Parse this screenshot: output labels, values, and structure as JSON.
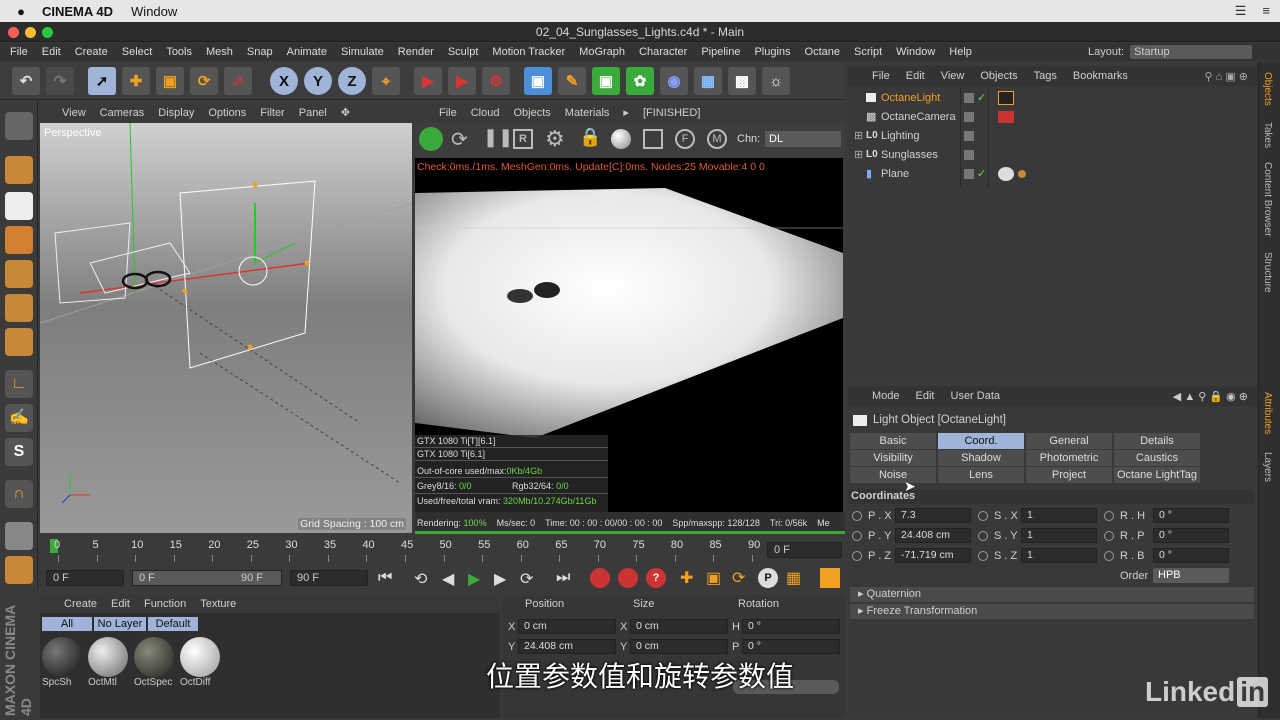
{
  "mac_menu": {
    "app": "CINEMA 4D",
    "window": "Window"
  },
  "window_title": "02_04_Sunglasses_Lights.c4d * - Main",
  "main_menu": [
    "File",
    "Edit",
    "Create",
    "Select",
    "Tools",
    "Mesh",
    "Snap",
    "Animate",
    "Simulate",
    "Render",
    "Sculpt",
    "Motion Tracker",
    "MoGraph",
    "Character",
    "Pipeline",
    "Plugins",
    "Octane",
    "Script",
    "Window",
    "Help"
  ],
  "layout": {
    "label": "Layout:",
    "value": "Startup"
  },
  "toolbar": {
    "x": "X",
    "y": "Y",
    "z": "Z"
  },
  "viewport": {
    "menu": [
      "View",
      "Cameras",
      "Display",
      "Options",
      "Filter",
      "Panel"
    ],
    "label": "Perspective",
    "grid_spacing": "Grid Spacing : 100 cm"
  },
  "render_view": {
    "menu": [
      "File",
      "Cloud",
      "Objects",
      "Materials"
    ],
    "status": "[FINISHED]",
    "channel_label": "Chn:",
    "channel_value": "DL",
    "info": "Check:0ms./1ms. MeshGen:0ms. Update[C]:0ms. Nodes:25 Movable:4  0 0",
    "gpu1": "GTX 1080 Ti[T][6.1]",
    "gpu2": "GTX 1080 Ti[6.1]",
    "out_of_core_label": "Out-of-core used/max:",
    "out_of_core_value": "0Kb/4Gb",
    "grey_label": "Grey8/16:",
    "grey_value": "0/0",
    "rgb_label": "Rgb32/64:",
    "rgb_value": "0/0",
    "vram_label": "Used/free/total vram:",
    "vram_value": "320Mb/10.274Gb/11Gb",
    "rendering_label": "Rendering:",
    "rendering_value": "100%",
    "ms_sec": "Ms/sec: 0",
    "time": "Time: 00 : 00 : 00/00 : 00 : 00",
    "spp": "Spp/maxspp: 128/128",
    "tri": "Tri: 0/56k",
    "me": "Me"
  },
  "timeline": {
    "ticks": [
      "0",
      "5",
      "10",
      "15",
      "20",
      "25",
      "30",
      "35",
      "40",
      "45",
      "50",
      "55",
      "60",
      "65",
      "70",
      "75",
      "80",
      "85",
      "90"
    ],
    "current_frame": "0 F",
    "start": "0 F",
    "min": "0 F",
    "max_inner": "90 F",
    "end": "90 F"
  },
  "material_manager": {
    "menu": [
      "Create",
      "Edit",
      "Function",
      "Texture"
    ],
    "filters": [
      "All",
      "No Layer",
      "Default"
    ],
    "materials": [
      "SpcSh",
      "OctMtl",
      "OctSpec",
      "OctDiff"
    ]
  },
  "coordinates_manager": {
    "headers": [
      "Position",
      "Size",
      "Rotation"
    ],
    "rows": [
      {
        "a": "X",
        "pos": "0 cm",
        "b": "X",
        "size": "0 cm",
        "c": "H",
        "rot": "0 °"
      },
      {
        "a": "Y",
        "pos": "24.408 cm",
        "b": "Y",
        "size": "0 cm",
        "c": "P",
        "rot": "0 °"
      }
    ]
  },
  "objects_manager": {
    "menu": [
      "File",
      "Edit",
      "View",
      "Objects",
      "Tags",
      "Bookmarks"
    ],
    "objects": [
      "OctaneLight",
      "OctaneCamera",
      "Lighting",
      "Sunglasses",
      "Plane"
    ]
  },
  "attributes": {
    "menu": [
      "Mode",
      "Edit",
      "User Data"
    ],
    "title": "Light Object [OctaneLight]",
    "tabs_row1": [
      "Basic",
      "Coord.",
      "General",
      "Details"
    ],
    "tabs_row2": [
      "Visibility",
      "Shadow",
      "Photometric",
      "Caustics"
    ],
    "tabs_row3": [
      "Noise",
      "Lens",
      "Project",
      "Octane LightTag"
    ],
    "section": "Coordinates",
    "coords": [
      {
        "p_label": "P . X",
        "p_val": "7.3",
        "s_label": "S . X",
        "s_val": "1",
        "r_label": "R . H",
        "r_val": "0 °"
      },
      {
        "p_label": "P . Y",
        "p_val": "24.408 cm",
        "s_label": "S . Y",
        "s_val": "1",
        "r_label": "R . P",
        "r_val": "0 °"
      },
      {
        "p_label": "P . Z",
        "p_val": "-71.719 cm",
        "s_label": "S . Z",
        "s_val": "1",
        "r_label": "R . B",
        "r_val": "0 °"
      }
    ],
    "order_label": "Order",
    "order_value": "HPB",
    "collapsed": [
      "Quaternion",
      "Freeze Transformation"
    ]
  },
  "side_tabs": [
    "Objects",
    "Takes",
    "Content Browser",
    "Structure",
    "Attributes",
    "Layers"
  ],
  "left_brand": "MAXON CINEMA 4D",
  "subtitle": "位置参数值和旋转参数值",
  "watermark": {
    "text": "Linked",
    "in": "in"
  },
  "colors": {
    "accent_blue": "#9fb4d8",
    "selected_orange": "#f0a020",
    "render_info_red": "#e05a30",
    "stat_green": "#6fd64a"
  }
}
